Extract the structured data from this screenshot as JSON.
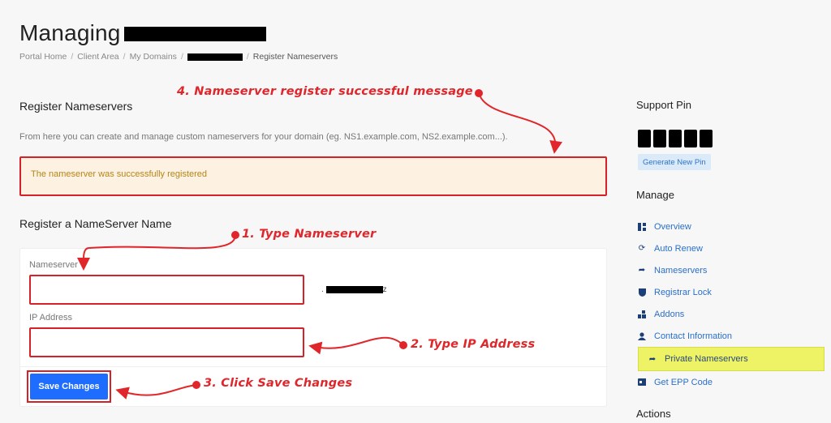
{
  "header": {
    "title_prefix": "Managing"
  },
  "breadcrumb": {
    "items": [
      "Portal Home",
      "Client Area",
      "My Domains"
    ],
    "current": "Register Nameservers"
  },
  "register_section": {
    "heading": "Register Nameservers",
    "description": "From here you can create and manage custom nameservers for your domain (eg. NS1.example.com, NS2.example.com...).",
    "alert_text": "The nameserver was successfully registered"
  },
  "form": {
    "heading": "Register a NameServer Name",
    "nameserver_label": "Nameserver",
    "nameserver_value": "",
    "suffix_prefix": ".",
    "suffix_tail": "z",
    "ip_label": "IP Address",
    "ip_value": "",
    "save_label": "Save Changes"
  },
  "annotations": {
    "step4": "4. Nameserver register successful message",
    "step1": "1. Type Nameserver",
    "step2": "2. Type IP Address",
    "step3": "3. Click Save Changes",
    "color": "#e0262a"
  },
  "sidebar": {
    "support_pin_heading": "Support Pin",
    "generate_pin_label": "Generate New Pin",
    "manage_heading": "Manage",
    "items": [
      {
        "label": "Overview",
        "icon": "overview-icon"
      },
      {
        "label": "Auto Renew",
        "icon": "sync-icon"
      },
      {
        "label": "Nameservers",
        "icon": "share-arrow-icon"
      },
      {
        "label": "Registrar Lock",
        "icon": "shield-icon"
      },
      {
        "label": "Addons",
        "icon": "cubes-icon"
      },
      {
        "label": "Contact Information",
        "icon": "user-icon"
      },
      {
        "label": "Private Nameservers",
        "icon": "share-arrow-icon",
        "active": true
      },
      {
        "label": "Get EPP Code",
        "icon": "id-card-icon"
      }
    ],
    "actions_heading": "Actions"
  },
  "colors": {
    "accent": "#1e6dff",
    "link": "#2a6fc9",
    "highlight": "#eef265",
    "alert_bg": "#fdf1e1",
    "alert_text": "#b3861a"
  }
}
